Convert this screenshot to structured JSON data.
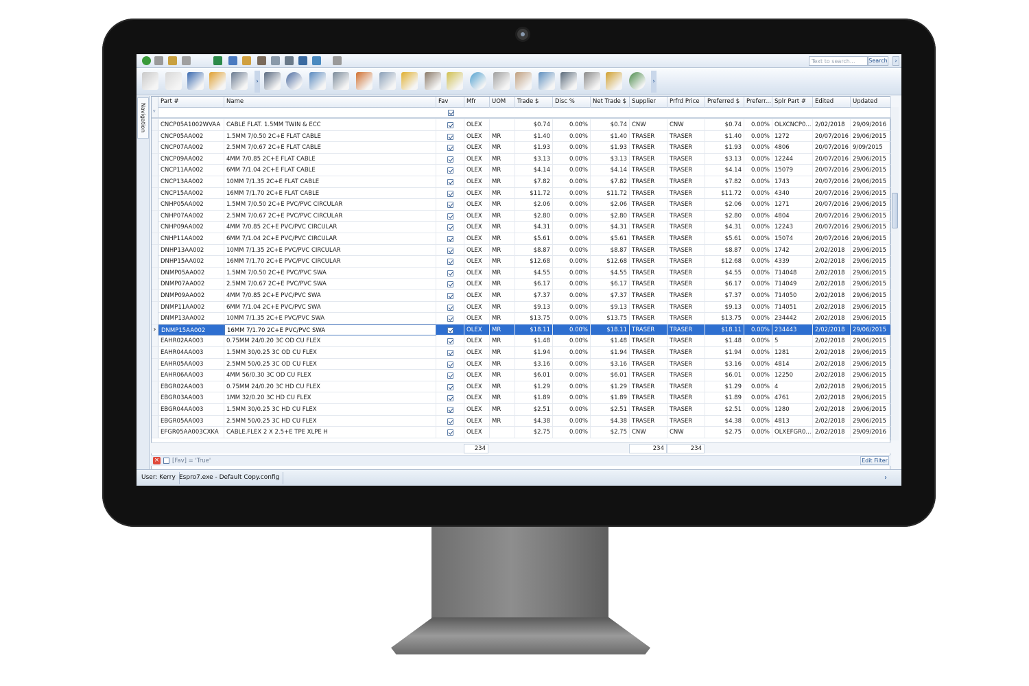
{
  "app": {
    "search_placeholder": "Text to search...",
    "search_label": "Search",
    "nav_label": "Navigation"
  },
  "columns": [
    "Part #",
    "Name",
    "Fav",
    "Mfr",
    "UOM",
    "Trade $",
    "Disc %",
    "Net Trade $",
    "Supplier",
    "Prfrd Price",
    "Preferred $",
    "Preferr...",
    "Splr Part #",
    "Edited",
    "Updated"
  ],
  "rows": [
    [
      "CNCP05A1002WVAA",
      "CABLE FLAT. 1.5MM TWIN & ECC",
      "OLEX",
      "",
      "$0.74",
      "0.00%",
      "$0.74",
      "CNW",
      "CNW",
      "$0.74",
      "0.00%",
      "OLXCNCP0...",
      "2/02/2018",
      "29/09/2016"
    ],
    [
      "CNCP05AA002",
      "1.5MM 7/0.50 2C+E FLAT CABLE",
      "OLEX",
      "MR",
      "$1.40",
      "0.00%",
      "$1.40",
      "TRASER",
      "TRASER",
      "$1.40",
      "0.00%",
      "1272",
      "20/07/2016",
      "29/06/2015"
    ],
    [
      "CNCP07AA002",
      "2.5MM 7/0.67 2C+E FLAT CABLE",
      "OLEX",
      "MR",
      "$1.93",
      "0.00%",
      "$1.93",
      "TRASER",
      "TRASER",
      "$1.93",
      "0.00%",
      "4806",
      "20/07/2016",
      "9/09/2015"
    ],
    [
      "CNCP09AA002",
      "4MM 7/0.85 2C+E FLAT CABLE",
      "OLEX",
      "MR",
      "$3.13",
      "0.00%",
      "$3.13",
      "TRASER",
      "TRASER",
      "$3.13",
      "0.00%",
      "12244",
      "20/07/2016",
      "29/06/2015"
    ],
    [
      "CNCP11AA002",
      "6MM 7/1.04 2C+E FLAT CABLE",
      "OLEX",
      "MR",
      "$4.14",
      "0.00%",
      "$4.14",
      "TRASER",
      "TRASER",
      "$4.14",
      "0.00%",
      "15079",
      "20/07/2016",
      "29/06/2015"
    ],
    [
      "CNCP13AA002",
      "10MM 7/1.35 2C+E FLAT CABLE",
      "OLEX",
      "MR",
      "$7.82",
      "0.00%",
      "$7.82",
      "TRASER",
      "TRASER",
      "$7.82",
      "0.00%",
      "1743",
      "20/07/2016",
      "29/06/2015"
    ],
    [
      "CNCP15AA002",
      "16MM 7/1.70 2C+E FLAT CABLE",
      "OLEX",
      "MR",
      "$11.72",
      "0.00%",
      "$11.72",
      "TRASER",
      "TRASER",
      "$11.72",
      "0.00%",
      "4340",
      "20/07/2016",
      "29/06/2015"
    ],
    [
      "CNHP05AA002",
      "1.5MM 7/0.50 2C+E PVC/PVC CIRCULAR",
      "OLEX",
      "MR",
      "$2.06",
      "0.00%",
      "$2.06",
      "TRASER",
      "TRASER",
      "$2.06",
      "0.00%",
      "1271",
      "20/07/2016",
      "29/06/2015"
    ],
    [
      "CNHP07AA002",
      "2.5MM 7/0.67 2C+E PVC/PVC CIRCULAR",
      "OLEX",
      "MR",
      "$2.80",
      "0.00%",
      "$2.80",
      "TRASER",
      "TRASER",
      "$2.80",
      "0.00%",
      "4804",
      "20/07/2016",
      "29/06/2015"
    ],
    [
      "CNHP09AA002",
      "4MM 7/0.85 2C+E PVC/PVC CIRCULAR",
      "OLEX",
      "MR",
      "$4.31",
      "0.00%",
      "$4.31",
      "TRASER",
      "TRASER",
      "$4.31",
      "0.00%",
      "12243",
      "20/07/2016",
      "29/06/2015"
    ],
    [
      "CNHP11AA002",
      "6MM 7/1.04 2C+E PVC/PVC CIRCULAR",
      "OLEX",
      "MR",
      "$5.61",
      "0.00%",
      "$5.61",
      "TRASER",
      "TRASER",
      "$5.61",
      "0.00%",
      "15074",
      "20/07/2016",
      "29/06/2015"
    ],
    [
      "DNHP13AA002",
      "10MM 7/1.35 2C+E PVC/PVC CIRCULAR",
      "OLEX",
      "MR",
      "$8.87",
      "0.00%",
      "$8.87",
      "TRASER",
      "TRASER",
      "$8.87",
      "0.00%",
      "1742",
      "2/02/2018",
      "29/06/2015"
    ],
    [
      "DNHP15AA002",
      "16MM 7/1.70 2C+E PVC/PVC CIRCULAR",
      "OLEX",
      "MR",
      "$12.68",
      "0.00%",
      "$12.68",
      "TRASER",
      "TRASER",
      "$12.68",
      "0.00%",
      "4339",
      "2/02/2018",
      "29/06/2015"
    ],
    [
      "DNMP05AA002",
      "1.5MM 7/0.50 2C+E PVC/PVC SWA",
      "OLEX",
      "MR",
      "$4.55",
      "0.00%",
      "$4.55",
      "TRASER",
      "TRASER",
      "$4.55",
      "0.00%",
      "714048",
      "2/02/2018",
      "29/06/2015"
    ],
    [
      "DNMP07AA002",
      "2.5MM 7/0.67 2C+E PVC/PVC SWA",
      "OLEX",
      "MR",
      "$6.17",
      "0.00%",
      "$6.17",
      "TRASER",
      "TRASER",
      "$6.17",
      "0.00%",
      "714049",
      "2/02/2018",
      "29/06/2015"
    ],
    [
      "DNMP09AA002",
      "4MM 7/0.85 2C+E PVC/PVC SWA",
      "OLEX",
      "MR",
      "$7.37",
      "0.00%",
      "$7.37",
      "TRASER",
      "TRASER",
      "$7.37",
      "0.00%",
      "714050",
      "2/02/2018",
      "29/06/2015"
    ],
    [
      "DNMP11AA002",
      "6MM 7/1.04 2C+E PVC/PVC SWA",
      "OLEX",
      "MR",
      "$9.13",
      "0.00%",
      "$9.13",
      "TRASER",
      "TRASER",
      "$9.13",
      "0.00%",
      "714051",
      "2/02/2018",
      "29/06/2015"
    ],
    [
      "DNMP13AA002",
      "10MM 7/1.35 2C+E PVC/PVC SWA",
      "OLEX",
      "MR",
      "$13.75",
      "0.00%",
      "$13.75",
      "TRASER",
      "TRASER",
      "$13.75",
      "0.00%",
      "234442",
      "2/02/2018",
      "29/06/2015"
    ],
    [
      "DNMP15AA002",
      "16MM 7/1.70 2C+E PVC/PVC SWA",
      "OLEX",
      "MR",
      "$18.11",
      "0.00%",
      "$18.11",
      "TRASER",
      "TRASER",
      "$18.11",
      "0.00%",
      "234443",
      "2/02/2018",
      "29/06/2015"
    ],
    [
      "EAHR02AA003",
      "0.75MM 24/0.20 3C OD CU FLEX",
      "OLEX",
      "MR",
      "$1.48",
      "0.00%",
      "$1.48",
      "TRASER",
      "TRASER",
      "$1.48",
      "0.00%",
      "5",
      "2/02/2018",
      "29/06/2015"
    ],
    [
      "EAHR04AA003",
      "1.5MM 30/0.25 3C OD CU FLEX",
      "OLEX",
      "MR",
      "$1.94",
      "0.00%",
      "$1.94",
      "TRASER",
      "TRASER",
      "$1.94",
      "0.00%",
      "1281",
      "2/02/2018",
      "29/06/2015"
    ],
    [
      "EAHR05AA003",
      "2.5MM 50/0.25 3C OD CU FLEX",
      "OLEX",
      "MR",
      "$3.16",
      "0.00%",
      "$3.16",
      "TRASER",
      "TRASER",
      "$3.16",
      "0.00%",
      "4814",
      "2/02/2018",
      "29/06/2015"
    ],
    [
      "EAHR06AA003",
      "4MM 56/0.30 3C OD CU FLEX",
      "OLEX",
      "MR",
      "$6.01",
      "0.00%",
      "$6.01",
      "TRASER",
      "TRASER",
      "$6.01",
      "0.00%",
      "12250",
      "2/02/2018",
      "29/06/2015"
    ],
    [
      "EBGR02AA003",
      "0.75MM 24/0.20 3C HD CU FLEX",
      "OLEX",
      "MR",
      "$1.29",
      "0.00%",
      "$1.29",
      "TRASER",
      "TRASER",
      "$1.29",
      "0.00%",
      "4",
      "2/02/2018",
      "29/06/2015"
    ],
    [
      "EBGR03AA003",
      "1MM 32/0.20 3C HD CU FLEX",
      "OLEX",
      "MR",
      "$1.89",
      "0.00%",
      "$1.89",
      "TRASER",
      "TRASER",
      "$1.89",
      "0.00%",
      "4761",
      "2/02/2018",
      "29/06/2015"
    ],
    [
      "EBGR04AA003",
      "1.5MM 30/0.25 3C HD CU FLEX",
      "OLEX",
      "MR",
      "$2.51",
      "0.00%",
      "$2.51",
      "TRASER",
      "TRASER",
      "$2.51",
      "0.00%",
      "1280",
      "2/02/2018",
      "29/06/2015"
    ],
    [
      "EBGR05AA003",
      "2.5MM 50/0.25 3C HD CU FLEX",
      "OLEX",
      "MR",
      "$4.38",
      "0.00%",
      "$4.38",
      "TRASER",
      "TRASER",
      "$4.38",
      "0.00%",
      "4813",
      "2/02/2018",
      "29/06/2015"
    ],
    [
      "EFGR05AA003CXKA",
      "CABLE.FLEX 2 X 2.5+E TPE XLPE H",
      "OLEX",
      "",
      "$2.75",
      "0.00%",
      "$2.75",
      "CNW",
      "CNW",
      "$2.75",
      "0.00%",
      "OLXEFGR0...",
      "2/02/2018",
      "29/09/2016"
    ]
  ],
  "selected_row": 18,
  "footer": {
    "mfr_count": "234",
    "supplier_count": "234",
    "prfrd_count": "234"
  },
  "filter": {
    "text": "[Fav] = 'True'",
    "edit_label": "Edit Filter"
  },
  "status": {
    "user": "User: Kerry",
    "config": "Espro7.exe - Default Copy.config"
  },
  "colors": {
    "selection": "#2e6fd0",
    "ribbon_bg": "#dfe8f3",
    "bezel": "#111111"
  },
  "toolbar_icons": [
    "new-icon",
    "clip-icon",
    "edit-icon",
    "copy-icon",
    "refresh-icon",
    "window-icon",
    "hand-icon",
    "brush-icon",
    "eraser-icon",
    "arrow-icon",
    "save-icon",
    "export-icon",
    "print-icon"
  ],
  "ribbon_icons": [
    "notepad-icon",
    "pen-icon",
    "book-icon",
    "basket-icon",
    "cable-icon",
    "cable-drum-icon",
    "users-icon",
    "folder-grid-icon",
    "ladder-icon",
    "chart-icon",
    "document-edit-icon",
    "boxes-icon",
    "phone-icon",
    "report-icon",
    "color-wheel-icon",
    "paperclip-icon",
    "house-icon",
    "cable-gland-icon",
    "fuse-icon",
    "gear-icon",
    "ruler-icon",
    "user-admin-icon"
  ]
}
